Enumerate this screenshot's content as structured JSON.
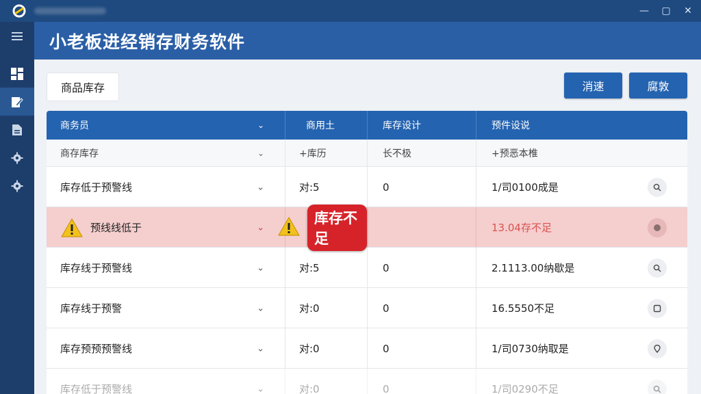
{
  "window": {
    "title": "",
    "minimize": "—",
    "restore": "▢",
    "close": "✕"
  },
  "sidebar": {
    "items": [
      {
        "icon": "menu-icon"
      },
      {
        "icon": "dashboard-icon"
      },
      {
        "icon": "edit-document-icon"
      },
      {
        "icon": "file-icon"
      },
      {
        "icon": "gear-icon"
      },
      {
        "icon": "gear-icon"
      }
    ]
  },
  "header": {
    "title": "小老板进经销存财务软件"
  },
  "toolbar": {
    "section_tab": "商品库存",
    "button_1": "消速",
    "button_2": "腐敦"
  },
  "table": {
    "headers": [
      "商务员",
      "商用土",
      "库存设计",
      "预件设说"
    ],
    "subheaders": [
      "商存库存",
      "+库历",
      "长不极",
      "+预恶本椎"
    ],
    "rows": [
      {
        "c1": "库存低于预警线",
        "c2": "对:5",
        "c3": "0",
        "c4": "1/司0100成是",
        "action_icon": "search-icon",
        "alert": false
      },
      {
        "c1": "预线线低于",
        "c2": "",
        "c3": "",
        "c4": "13.04存不足",
        "action_icon": "record-icon",
        "alert": true,
        "badge": "库存不足"
      },
      {
        "c1": "库存线于预警线",
        "c2": "对:5",
        "c3": "0",
        "c4": "2.1113.00纳歇是",
        "action_icon": "search-icon",
        "alert": false
      },
      {
        "c1": "库存线于预警",
        "c2": "对:0",
        "c3": "0",
        "c4": "16.5550不足",
        "action_icon": "square-icon",
        "alert": false
      },
      {
        "c1": "库存预预预警线",
        "c2": "对:0",
        "c3": "0",
        "c4": "1/司0730纳取是",
        "action_icon": "location-icon",
        "alert": false
      },
      {
        "c1": "库存低于预警线",
        "c2": "对:0",
        "c3": "0",
        "c4": "1/司0290不足",
        "action_icon": "search-icon",
        "alert": false
      }
    ]
  },
  "colors": {
    "header_blue": "#2a5fa6",
    "table_header_blue": "#2463b0",
    "alert_row": "#f5cece",
    "badge_red": "#d6232a",
    "warning_yellow": "#f2c11c"
  }
}
